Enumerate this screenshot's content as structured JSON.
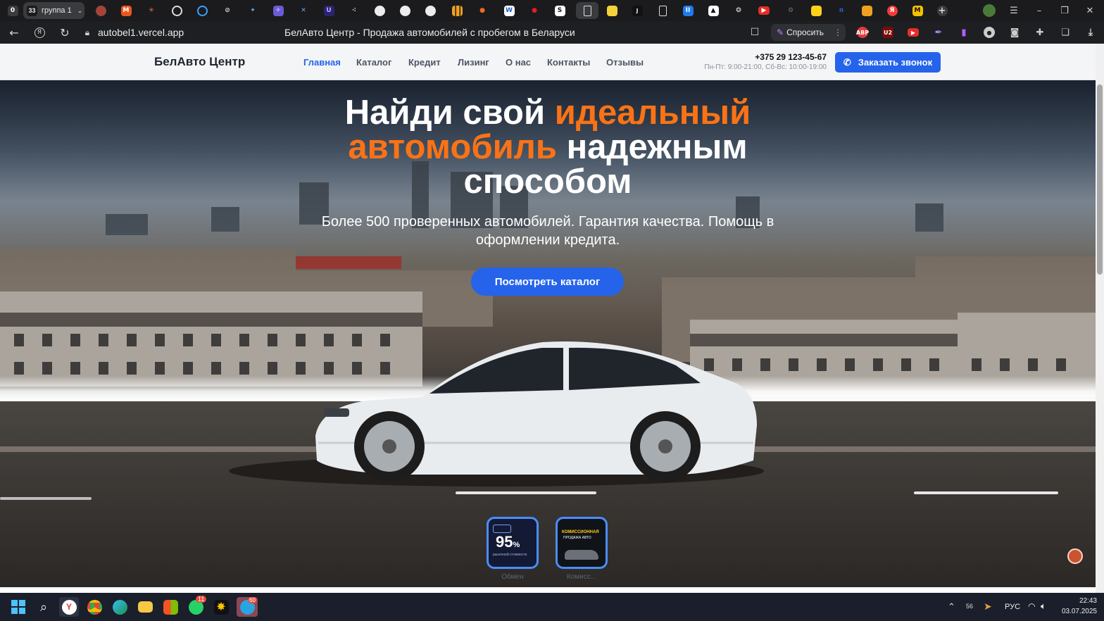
{
  "browser": {
    "workspace_badge": "0",
    "group": {
      "count": "33",
      "label": "группа 1"
    },
    "url": "autobel1.vercel.app",
    "page_title": "БелАвто Центр - Продажа автомобилей с пробегом в Беларуси",
    "ask_button": "Спросить",
    "ext_abp": "ABP",
    "ext_ublock": "U2"
  },
  "site": {
    "logo": "БелАвто Центр",
    "nav": [
      "Главная",
      "Каталог",
      "Кредит",
      "Лизинг",
      "О нас",
      "Контакты",
      "Отзывы"
    ],
    "active_nav": "Главная",
    "phone": "+375 29 123-45-67",
    "hours": "Пн-Пт: 9:00-21:00, Сб-Вс: 10:00-19:00",
    "call_button": "Заказать звонок",
    "hero": {
      "title_1": "Найди свой ",
      "title_accent_1": "идеальный",
      "title_accent_2": "автомобиль",
      "title_2": " надежным способом",
      "subtitle": "Более 500 проверенных автомобилей. Гарантия качества. Помощь в оформлении кредита.",
      "cta": "Посмотреть каталог"
    },
    "stories": [
      {
        "big": "95",
        "sub": "%",
        "small": "рыночной стоимости",
        "caption": "Обмен"
      },
      {
        "big": "КОМИССИОННАЯ",
        "sub": "ПРОДАЖА АВТО",
        "small": "",
        "caption": "Комисс..."
      }
    ]
  },
  "taskbar": {
    "whatsapp_badge": "11",
    "telegram_badge": "60",
    "tray_lang": "РУС",
    "tray_num": "56",
    "time": "22:43",
    "date": "03.07.2025"
  },
  "colors": {
    "accent": "#2563eb",
    "orange": "#f97316"
  }
}
